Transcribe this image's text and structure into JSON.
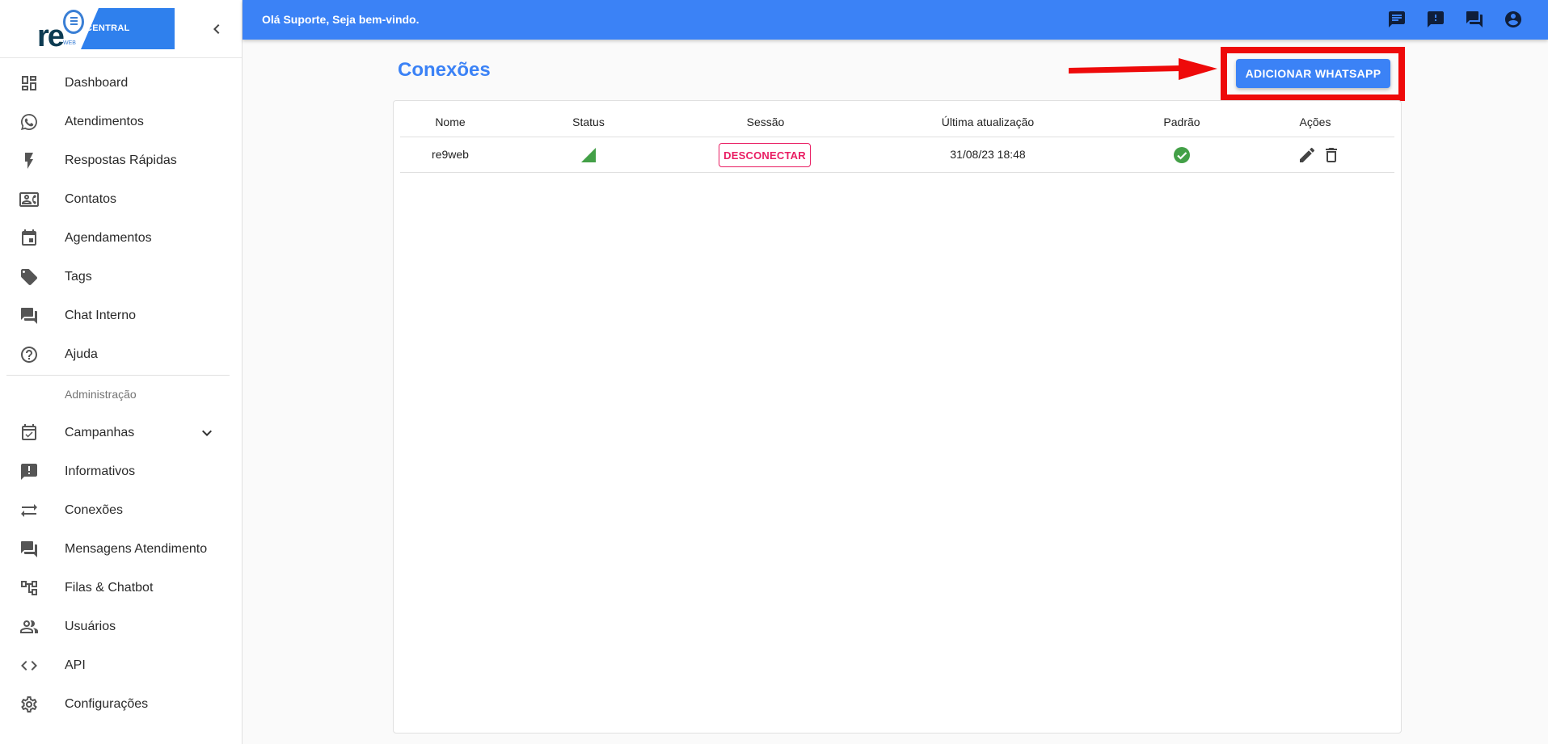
{
  "brand": {
    "logo_text": "re",
    "logo_sub": "WEB",
    "logo_box_label": "CENTRAL"
  },
  "topbar": {
    "greeting": "Olá Suporte, Seja bem-vindo.",
    "icons": [
      "chat-icon",
      "feedback-icon",
      "forum-icon",
      "account-circle-icon"
    ]
  },
  "sidebar": {
    "items": [
      {
        "label": "Dashboard",
        "icon": "dashboard-icon"
      },
      {
        "label": "Atendimentos",
        "icon": "whatsapp-icon"
      },
      {
        "label": "Respostas Rápidas",
        "icon": "flash-icon"
      },
      {
        "label": "Contatos",
        "icon": "contact-card-icon"
      },
      {
        "label": "Agendamentos",
        "icon": "calendar-icon"
      },
      {
        "label": "Tags",
        "icon": "tag-icon"
      },
      {
        "label": "Chat Interno",
        "icon": "forum-icon"
      },
      {
        "label": "Ajuda",
        "icon": "help-icon"
      }
    ],
    "admin_header": "Administração",
    "admin_items": [
      {
        "label": "Campanhas",
        "icon": "event-available-icon"
      },
      {
        "label": "Informativos",
        "icon": "announcement-icon"
      },
      {
        "label": "Conexões",
        "icon": "sync-alt-icon"
      },
      {
        "label": "Mensagens Atendimento",
        "icon": "forum-icon"
      },
      {
        "label": "Filas & Chatbot",
        "icon": "account-tree-icon"
      },
      {
        "label": "Usuários",
        "icon": "people-icon"
      },
      {
        "label": "API",
        "icon": "code-icon"
      },
      {
        "label": "Configurações",
        "icon": "settings-icon"
      }
    ]
  },
  "main": {
    "title": "Conexões",
    "add_button_label": "ADICIONAR WHATSAPP",
    "table": {
      "columns": [
        "Nome",
        "Status",
        "Sessão",
        "Última atualização",
        "Padrão",
        "Ações"
      ],
      "rows": [
        {
          "name": "re9web",
          "status": "connected",
          "session_button": "DESCONECTAR",
          "updated": "31/08/23 18:48",
          "default": true
        }
      ]
    }
  },
  "colors": {
    "primary": "#3b82f6",
    "annotation_red": "#ee0a0a",
    "danger": "#e91e63",
    "success": "#43a047"
  }
}
